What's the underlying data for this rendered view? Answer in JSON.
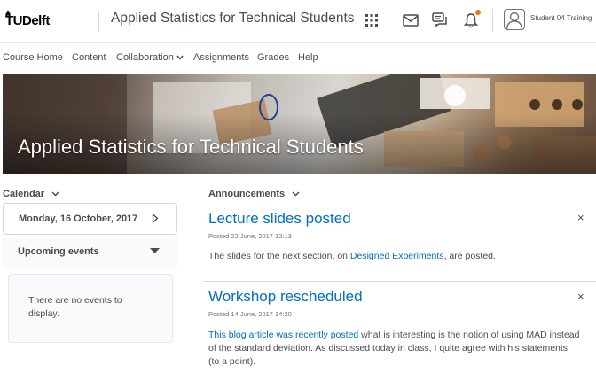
{
  "header": {
    "logo_text": "TUDelft",
    "course_title": "Applied Statistics for Technical Students",
    "user_name": "Student 04 Training",
    "icons": [
      "apps-grid-icon",
      "mail-icon",
      "chat-icon",
      "bell-icon",
      "user-icon"
    ],
    "notification_color": "#e87511"
  },
  "nav": {
    "items": [
      "Course Home",
      "Content",
      "Collaboration",
      "Assignments",
      "Grades",
      "Help"
    ]
  },
  "banner": {
    "title": "Applied Statistics for Technical Students"
  },
  "calendar": {
    "heading": "Calendar",
    "date": "Monday, 16 October, 2017",
    "upcoming_label": "Upcoming events",
    "no_events": "There are no events to display."
  },
  "announcements": {
    "heading": "Announcements",
    "items": [
      {
        "title": "Lecture slides posted",
        "posted": "Posted 22 June, 2017 12:13",
        "body_before": "The slides for the next section, on ",
        "body_link": "Designed Experiments",
        "body_after": ", are posted."
      },
      {
        "title": "Workshop rescheduled",
        "posted": "Posted 14 June, 2017 14:20",
        "body_link": "This blog article was recently posted",
        "body_after": "  what is interesting is the notion of using MAD instead of the standard deviation. As discussed today in class, I quite agree with his statements (to a point)."
      }
    ],
    "close_symbol": "×"
  },
  "colors": {
    "link": "#006fbf",
    "text": "#494c4e"
  }
}
